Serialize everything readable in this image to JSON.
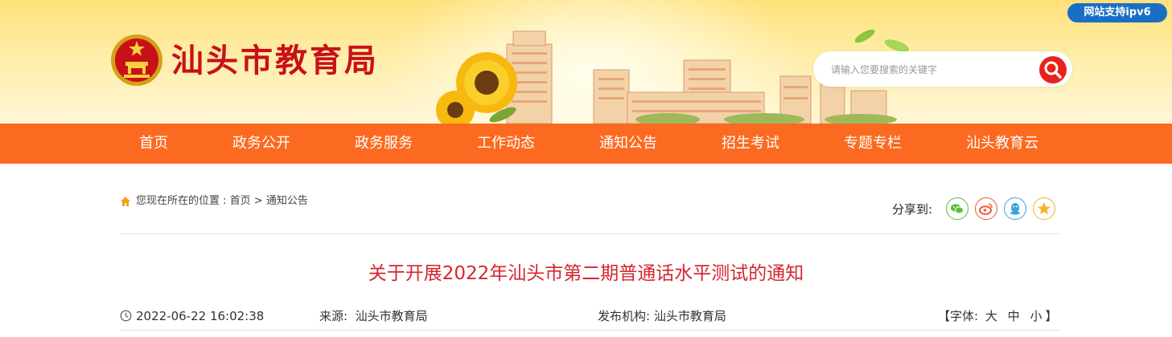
{
  "header": {
    "site_name": "汕头市教育局",
    "ipv6_badge": "网站支持ipv6",
    "search_placeholder": "请输入您要搜索的关键字"
  },
  "nav": {
    "items": [
      "首页",
      "政务公开",
      "政务服务",
      "工作动态",
      "通知公告",
      "招生考试",
      "专题专栏",
      "汕头教育云"
    ]
  },
  "breadcrumb": {
    "prefix": "您现在所在的位置 : ",
    "home": "首页",
    "separator": " > ",
    "current": "通知公告"
  },
  "share": {
    "label": "分享到:",
    "targets": [
      "wechat-icon",
      "weibo-icon",
      "qq-icon",
      "qzone-icon"
    ],
    "colors": {
      "wechat": "#5bbf3a",
      "weibo": "#f0583a",
      "qq": "#3ba0e6",
      "qzone": "#f2b526"
    }
  },
  "article": {
    "title": "关于开展2022年汕头市第二期普通话水平测试的通知",
    "datetime": "2022-06-22 16:02:38",
    "source_label": "来源:",
    "source": "汕头市教育局",
    "publisher_label": "发布机构:",
    "publisher": "汕头市教育局",
    "font_label": "【字体:",
    "font_large": "大",
    "font_medium": "中",
    "font_small": "小",
    "font_close": "】"
  },
  "colors": {
    "nav_bg": "#fb6a20",
    "title": "#d5262e",
    "brand_red": "#c8101a",
    "ipv6_bg": "#1a6fc4"
  }
}
